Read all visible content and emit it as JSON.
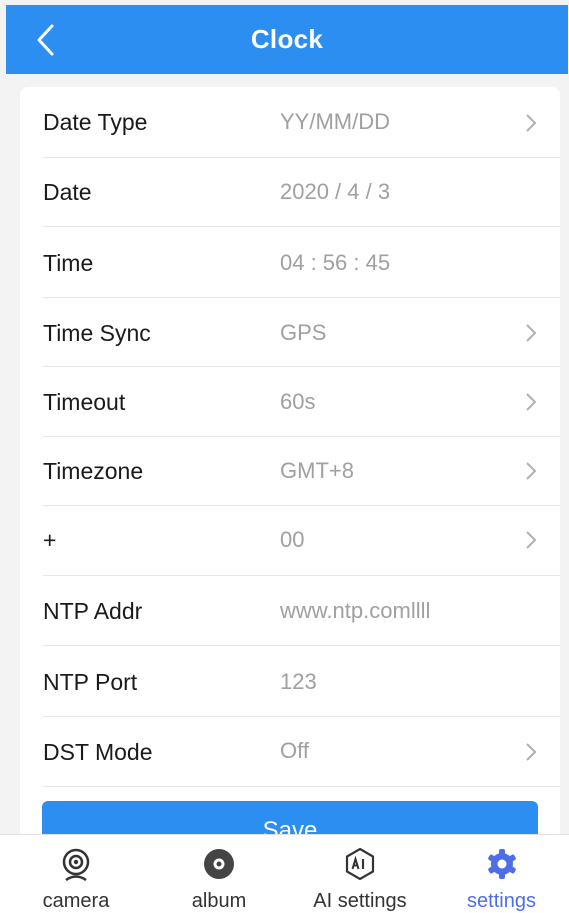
{
  "header": {
    "title": "Clock",
    "back_icon": "chevron-left-icon"
  },
  "settings": {
    "rows": [
      {
        "label": "Date Type",
        "value": "YY/MM/DD",
        "has_chevron": true
      },
      {
        "label": "Date",
        "value": "2020 / 4 / 3",
        "has_chevron": false
      },
      {
        "label": "Time",
        "value": "04 : 56 : 45",
        "has_chevron": false
      },
      {
        "label": "Time Sync",
        "value": "GPS",
        "has_chevron": true
      },
      {
        "label": "Timeout",
        "value": "60s",
        "has_chevron": true
      },
      {
        "label": "Timezone",
        "value": "GMT+8",
        "has_chevron": true
      },
      {
        "label": "+",
        "value": "00",
        "has_chevron": true
      },
      {
        "label": "NTP Addr",
        "value": "www.ntp.comllll",
        "has_chevron": false
      },
      {
        "label": "NTP Port",
        "value": "123",
        "has_chevron": false
      },
      {
        "label": "DST Mode",
        "value": "Off",
        "has_chevron": true
      }
    ],
    "save_label": "Save"
  },
  "tabbar": {
    "tabs": [
      {
        "label": "camera",
        "icon": "camera-icon",
        "active": false
      },
      {
        "label": "album",
        "icon": "album-icon",
        "active": false
      },
      {
        "label": "AI settings",
        "icon": "ai-icon",
        "active": false
      },
      {
        "label": "settings",
        "icon": "gear-icon",
        "active": true
      }
    ]
  },
  "colors": {
    "accent": "#2b8ef0",
    "active_tab": "#4f6ee6",
    "value_text": "#a0a0a0"
  }
}
